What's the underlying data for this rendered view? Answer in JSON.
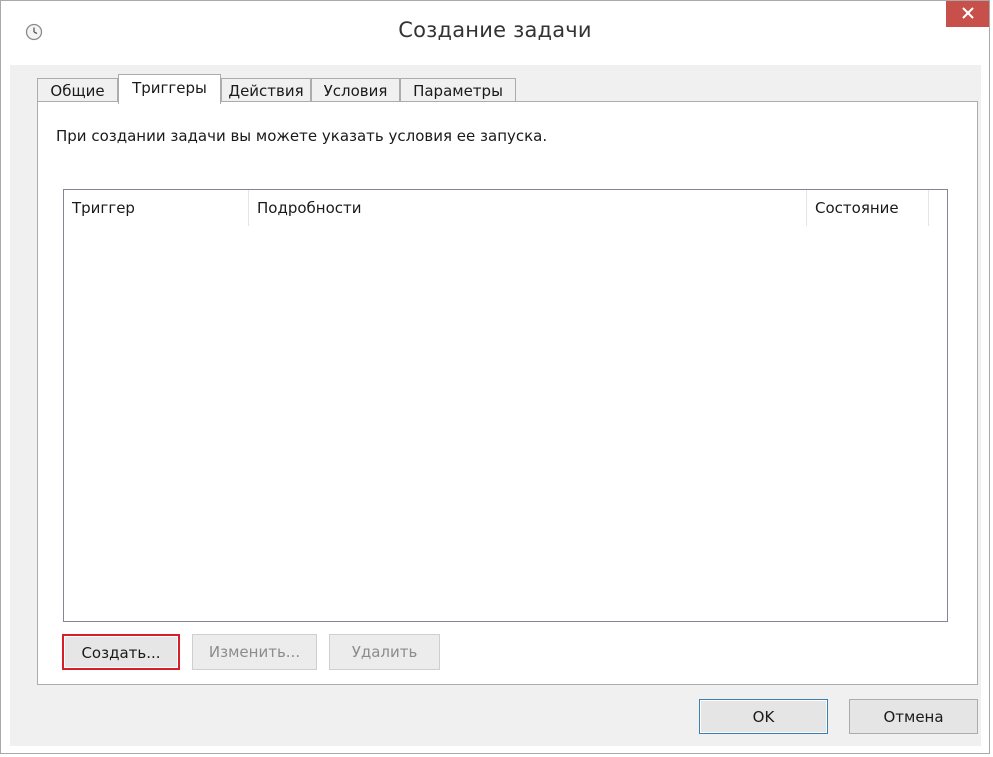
{
  "window": {
    "title": "Создание задачи",
    "close_symbol": "×",
    "title_icon": "clock-icon"
  },
  "tabs": [
    {
      "label": "Общие",
      "active": false
    },
    {
      "label": "Триггеры",
      "active": true
    },
    {
      "label": "Действия",
      "active": false
    },
    {
      "label": "Условия",
      "active": false
    },
    {
      "label": "Параметры",
      "active": false
    }
  ],
  "triggers_tab": {
    "intro_text": "При создании задачи вы можете указать условия ее запуска.",
    "columns": [
      "Триггер",
      "Подробности",
      "Состояние"
    ],
    "rows": [],
    "buttons": {
      "create": "Создать...",
      "edit": "Изменить...",
      "delete": "Удалить"
    }
  },
  "footer": {
    "ok": "OK",
    "cancel": "Отмена"
  },
  "colors": {
    "close_button": "#c7504a",
    "highlight_border": "#d32127",
    "default_button_border": "#3c7fb1",
    "client_background": "#f0f0f0"
  }
}
